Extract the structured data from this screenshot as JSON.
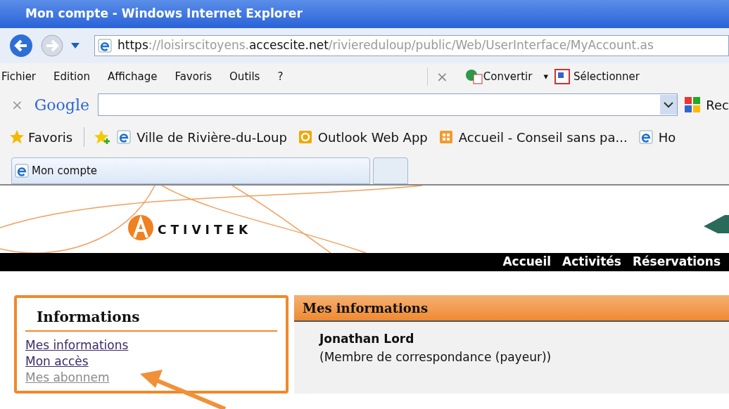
{
  "window": {
    "title": "Mon compte - Windows Internet Explorer"
  },
  "address_bar": {
    "url_scheme": "https",
    "url_sep": "://loisirscitoyens.",
    "url_domain": "accescite.net",
    "url_path": "/riviereduloup/public/Web/UserInterface/MyAccount.as"
  },
  "menu_bar": {
    "items": [
      "Fichier",
      "Edition",
      "Affichage",
      "Favoris",
      "Outils",
      "?"
    ],
    "close": "×",
    "tools": [
      "Convertir",
      "Sélectionner"
    ],
    "dropdown": "▾"
  },
  "google_bar": {
    "close": "×",
    "logo": "Google",
    "extra": "Rec"
  },
  "favorites_bar": {
    "label": "Favoris",
    "links": [
      {
        "kind": "ie",
        "label": "Ville de Rivière-du-Loup"
      },
      {
        "kind": "outlook",
        "label": "Outlook Web App"
      },
      {
        "kind": "grid",
        "label": "Accueil - Conseil sans pa..."
      },
      {
        "kind": "ie",
        "label": "Ho"
      }
    ]
  },
  "tabs": [
    {
      "label": "Mon compte",
      "selected": true
    },
    {
      "selected": false
    }
  ],
  "page": {
    "logo": "CTIVITEK",
    "nav": [
      "Accueil",
      "Activités",
      "Réservations"
    ],
    "sidebar": {
      "title": "Informations",
      "links": [
        {
          "label": "Mes informations",
          "faded": false
        },
        {
          "label": "Mon accès",
          "faded": false
        },
        {
          "label": "Mes abonnem",
          "faded": true
        }
      ]
    },
    "main": {
      "title": "Mes informations",
      "name": "Jonathan Lord",
      "role": "(Membre de correspondance (payeur))"
    }
  }
}
